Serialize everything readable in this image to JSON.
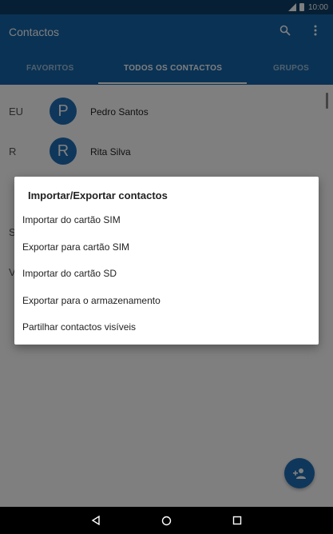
{
  "status_bar": {
    "time": "10:00"
  },
  "app_bar": {
    "title": "Contactos",
    "tabs": [
      {
        "label": "FAVORITOS",
        "active": false
      },
      {
        "label": "TODOS OS CONTACTOS",
        "active": true
      },
      {
        "label": "GRUPOS",
        "active": false
      }
    ]
  },
  "contacts": [
    {
      "section": "EU",
      "initial": "P",
      "name": "Pedro Santos"
    },
    {
      "section": "R",
      "initial": "R",
      "name": "Rita Silva"
    }
  ],
  "background_letters": [
    "S",
    "V"
  ],
  "dialog": {
    "title": "Importar/Exportar contactos",
    "items": [
      "Importar do cartão SIM",
      "Exportar para cartão SIM",
      "Importar do cartão SD",
      "Exportar para o armazenamento",
      "Partilhar contactos visíveis"
    ]
  },
  "colors": {
    "app_bar": "#1565a8",
    "status_bar": "#0d3e68",
    "avatar": "#1e6fb7",
    "fab": "#1e6fb7"
  },
  "icons": {
    "search": "search-icon",
    "more": "more-vert-icon",
    "fab": "add-person-icon",
    "nav_back": "back-triangle-icon",
    "nav_home": "home-circle-icon",
    "nav_recents": "recents-square-icon"
  }
}
